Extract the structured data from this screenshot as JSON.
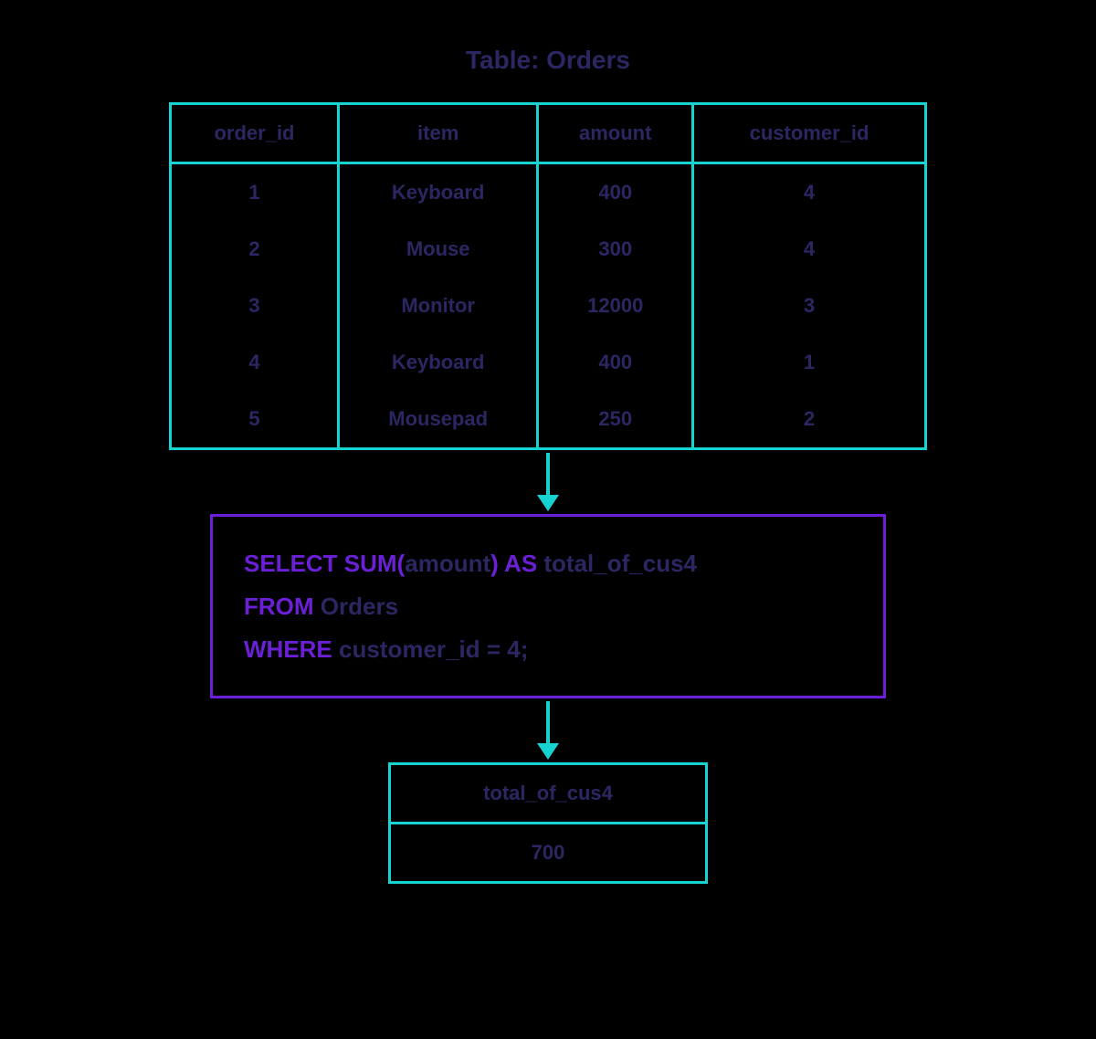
{
  "title": "Table: Orders",
  "orders": {
    "headers": [
      "order_id",
      "item",
      "amount",
      "customer_id"
    ],
    "rows": [
      [
        "1",
        "Keyboard",
        "400",
        "4"
      ],
      [
        "2",
        "Mouse",
        "300",
        "4"
      ],
      [
        "3",
        "Monitor",
        "12000",
        "3"
      ],
      [
        "4",
        "Keyboard",
        "400",
        "1"
      ],
      [
        "5",
        "Mousepad",
        "250",
        "2"
      ]
    ]
  },
  "query": {
    "line1_kw1": "SELECT SUM(",
    "line1_mid": "amount",
    "line1_kw2": ") AS ",
    "line1_end": "total_of_cus4",
    "line2_kw": "FROM ",
    "line2_end": "Orders",
    "line3_kw": "WHERE ",
    "line3_end": "customer_id = 4;"
  },
  "result": {
    "header": "total_of_cus4",
    "value": "700"
  }
}
